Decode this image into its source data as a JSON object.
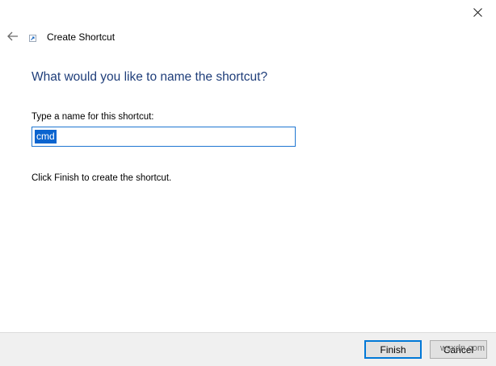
{
  "window": {
    "close_icon": "close-icon"
  },
  "header": {
    "back_icon": "back-arrow-icon",
    "app_icon": "shortcut-icon",
    "title": "Create Shortcut"
  },
  "main": {
    "heading": "What would you like to name the shortcut?",
    "name_label": "Type a name for this shortcut:",
    "name_value": "cmd",
    "info": "Click Finish to create the shortcut."
  },
  "footer": {
    "finish_label": "Finish",
    "cancel_label": "Cancel",
    "watermark": "wsxdn.com"
  },
  "colors": {
    "heading": "#1f3e7a",
    "selection": "#0a64cf",
    "primary_border": "#0078d7",
    "footer_bg": "#f0f0f0"
  }
}
